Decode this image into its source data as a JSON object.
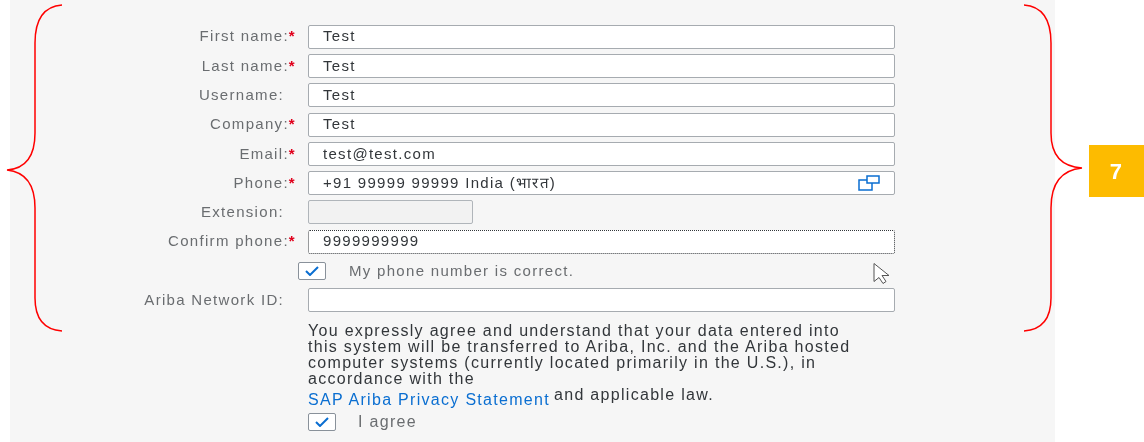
{
  "rows": [
    {
      "kind": "text",
      "label": "First name:",
      "required_mark": "*",
      "value": "Test",
      "disabled": false,
      "focused": false
    },
    {
      "kind": "text",
      "label": "Last name:",
      "required_mark": "*",
      "value": "Test",
      "disabled": false,
      "focused": false
    },
    {
      "kind": "text",
      "label": "Username:",
      "value": "Test",
      "disabled": false,
      "focused": false
    },
    {
      "kind": "text",
      "label": "Company:",
      "required_mark": "*",
      "value": "Test",
      "disabled": false,
      "focused": false
    },
    {
      "kind": "text",
      "label": "Email:",
      "required_mark": "*",
      "value": "test@test.com",
      "disabled": false,
      "focused": false
    },
    {
      "kind": "phone",
      "label": "Phone:",
      "required_mark": "*",
      "value": "+91 99999 99999 India (भारत)",
      "disabled": false,
      "focused": false
    },
    {
      "kind": "extension",
      "label": "Extension:",
      "disabled": true,
      "focused": false
    },
    {
      "kind": "text",
      "label": "Confirm phone:",
      "required_mark": "*",
      "value": "9999999999",
      "disabled": false,
      "focused": true
    },
    {
      "kind": "checkbox",
      "label": "My phone number is correct.",
      "checked": true
    },
    {
      "kind": "text",
      "label": "Ariba Network ID:",
      "disabled": false,
      "focused": false
    }
  ],
  "consent": {
    "text": "You expressly agree and understand that your data entered into this system will be transferred to Ariba, Inc. and the Ariba hosted computer systems (currently located primarily in the U.S.), in accordance with the",
    "link": "SAP Ariba Privacy Statement",
    "suffix": "and applicable law."
  },
  "agree": {
    "label": "I agree",
    "checked": true
  },
  "badge": "7"
}
